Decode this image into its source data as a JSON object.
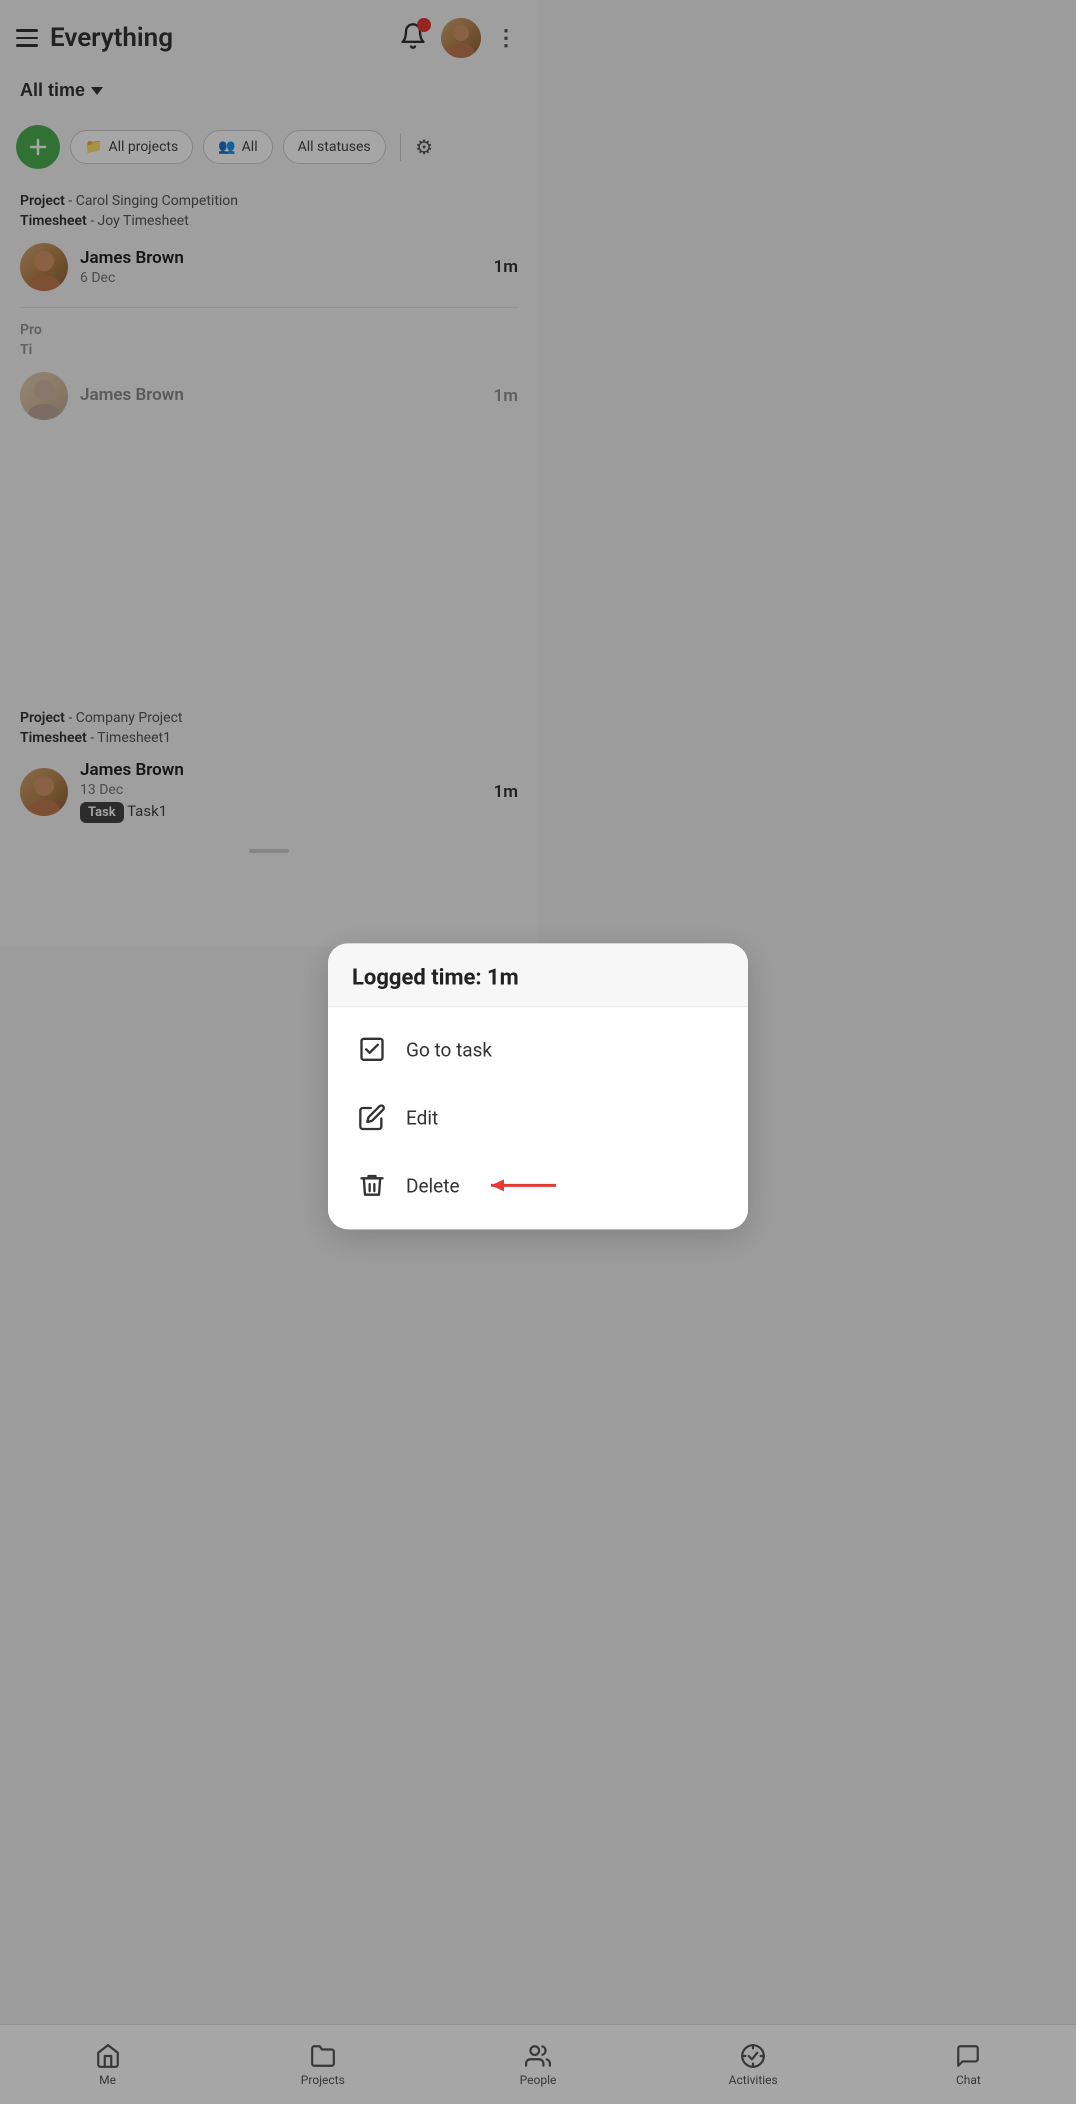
{
  "header": {
    "menu_icon": "hamburger-icon",
    "title": "Everything",
    "bell_icon": "bell-icon",
    "avatar_icon": "user-avatar",
    "more_icon": "more-options-icon"
  },
  "time_filter": {
    "label": "All time",
    "chevron": "chevron-down-icon"
  },
  "filter_bar": {
    "add_button": "+",
    "chips": [
      {
        "label": "All projects",
        "icon": "📁"
      },
      {
        "label": "All",
        "icon": "👥"
      },
      {
        "label": "All statuses"
      }
    ],
    "filter_icon": "sliders-icon"
  },
  "entries": [
    {
      "project_label": "Project",
      "project_name": "Carol Singing Competition",
      "timesheet_label": "Timesheet",
      "timesheet_name": "Joy Timesheet",
      "person_name": "James Brown",
      "date": "6 Dec",
      "time": "1m"
    },
    {
      "project_label": "Project",
      "project_name": "Company Project",
      "timesheet_label": "Timesheet",
      "timesheet_name": "Timesheet1",
      "person_name": "James Brown",
      "date": "13 Dec",
      "time": "1m",
      "tag": "Task",
      "task_name": "Task1"
    }
  ],
  "modal": {
    "title": "Logged time: 1m",
    "items": [
      {
        "label": "Go to task",
        "icon": "checkbox-icon"
      },
      {
        "label": "Edit",
        "icon": "pencil-icon"
      },
      {
        "label": "Delete",
        "icon": "trash-icon",
        "has_arrow": true
      }
    ]
  },
  "bottom_nav": {
    "items": [
      {
        "label": "Me",
        "icon": "home-icon",
        "active": false
      },
      {
        "label": "Projects",
        "icon": "folder-icon",
        "active": false
      },
      {
        "label": "People",
        "icon": "people-icon",
        "active": false
      },
      {
        "label": "Activities",
        "icon": "activities-icon",
        "active": false
      },
      {
        "label": "Chat",
        "icon": "chat-icon",
        "active": false
      }
    ]
  }
}
